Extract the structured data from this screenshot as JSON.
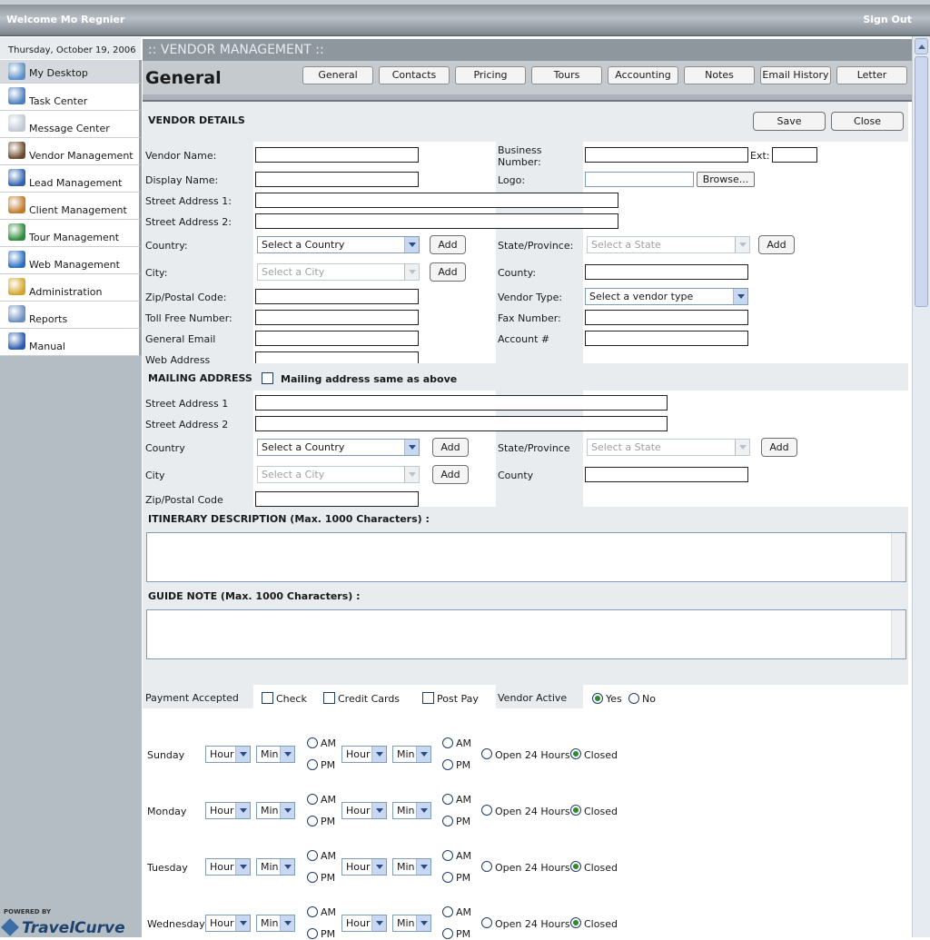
{
  "header": {
    "welcome": "Welcome Mo Regnier",
    "sign_out": "Sign Out"
  },
  "sidebar": {
    "date": "Thursday, October 19, 2006",
    "items": [
      {
        "label": "My Desktop",
        "icon": "desktop-icon",
        "color": "#5b8fc7"
      },
      {
        "label": "Task Center",
        "icon": "task-icon",
        "color": "#4a7fc0"
      },
      {
        "label": "Message Center",
        "icon": "envelope-icon",
        "color": "#c0c8d4"
      },
      {
        "label": "Vendor Management",
        "icon": "vendor-icon",
        "color": "#6b4a2a"
      },
      {
        "label": "Lead Management",
        "icon": "lead-icon",
        "color": "#2f62b0"
      },
      {
        "label": "Client Management",
        "icon": "client-icon",
        "color": "#c27a2a"
      },
      {
        "label": "Tour Management",
        "icon": "globe-icon",
        "color": "#2e8b3a"
      },
      {
        "label": "Web Management",
        "icon": "web-icon",
        "color": "#2a6ec2"
      },
      {
        "label": "Administration",
        "icon": "lock-icon",
        "color": "#d4a52a"
      },
      {
        "label": "Reports",
        "icon": "reports-icon",
        "color": "#6a8ec0"
      },
      {
        "label": "Manual",
        "icon": "help-icon",
        "color": "#2a5ab0"
      }
    ],
    "logo_powered": "POWERED BY",
    "logo_name": "TravelCurve"
  },
  "module_title": ":: VENDOR MANAGEMENT ::",
  "page_title": "General",
  "tabs": [
    "General",
    "Contacts",
    "Pricing",
    "Tours",
    "Accounting",
    "Notes",
    "Email History",
    "Letter"
  ],
  "vendor_details": {
    "section": "VENDOR DETAILS",
    "save": "Save",
    "close": "Close",
    "vendor_name": "Vendor Name:",
    "business_number": "Business Number:",
    "ext": "Ext:",
    "display_name": "Display Name:",
    "logo": "Logo:",
    "browse": "Browse...",
    "street1": "Street Address 1:",
    "street2": "Street Address 2:",
    "country": "Country:",
    "country_select": "Select a Country",
    "add": "Add",
    "state": "State/Province:",
    "state_select": "Select a State",
    "city": "City:",
    "city_select": "Select a City",
    "county": "County:",
    "zip": "Zip/Postal Code:",
    "vendor_type": "Vendor Type:",
    "vendor_type_select": "Select a vendor type",
    "toll_free": "Toll Free Number:",
    "fax": "Fax Number:",
    "email": "General Email",
    "account": "Account #",
    "web": "Web Address"
  },
  "mailing": {
    "section": "MAILING ADDRESS",
    "same": "Mailing address same as above",
    "street1": "Street Address 1",
    "street2": "Street Address 2",
    "country": "Country",
    "country_select": "Select a Country",
    "add": "Add",
    "state": "State/Province",
    "state_select": "Select a State",
    "city": "City",
    "city_select": "Select a City",
    "county": "County",
    "zip": "Zip/Postal Code"
  },
  "itinerary_label": "ITINERARY DESCRIPTION (Max. 1000 Characters) :",
  "guide_label": "GUIDE NOTE (Max. 1000 Characters) :",
  "payment": {
    "label": "Payment Accepted",
    "check": "Check",
    "credit": "Credit Cards",
    "post": "Post Pay",
    "active_label": "Vendor Active",
    "yes": "Yes",
    "no": "No",
    "active": "Yes"
  },
  "hours": {
    "hour": "Hour",
    "min": "Min",
    "am": "AM",
    "pm": "PM",
    "open24": "Open 24 Hours",
    "closed": "Closed",
    "days": [
      "Sunday",
      "Monday",
      "Tuesday",
      "Wednesday"
    ],
    "selected": "Closed"
  }
}
